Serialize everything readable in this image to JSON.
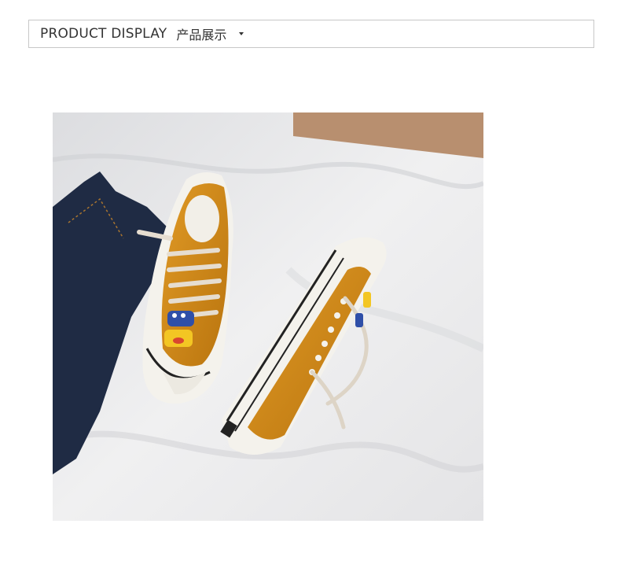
{
  "header": {
    "title": "PRODUCT DISPLAY",
    "subtitle": "产品展示",
    "dropdown_icon": "caret-down-icon"
  },
  "product_image": {
    "scene": "product photo of orange canvas sneakers with character lace charms",
    "colors": {
      "sheet": "#ebebec",
      "shoe": "#d08a1c",
      "jeans": "#1f2b44",
      "box": "#b88f6f"
    }
  }
}
